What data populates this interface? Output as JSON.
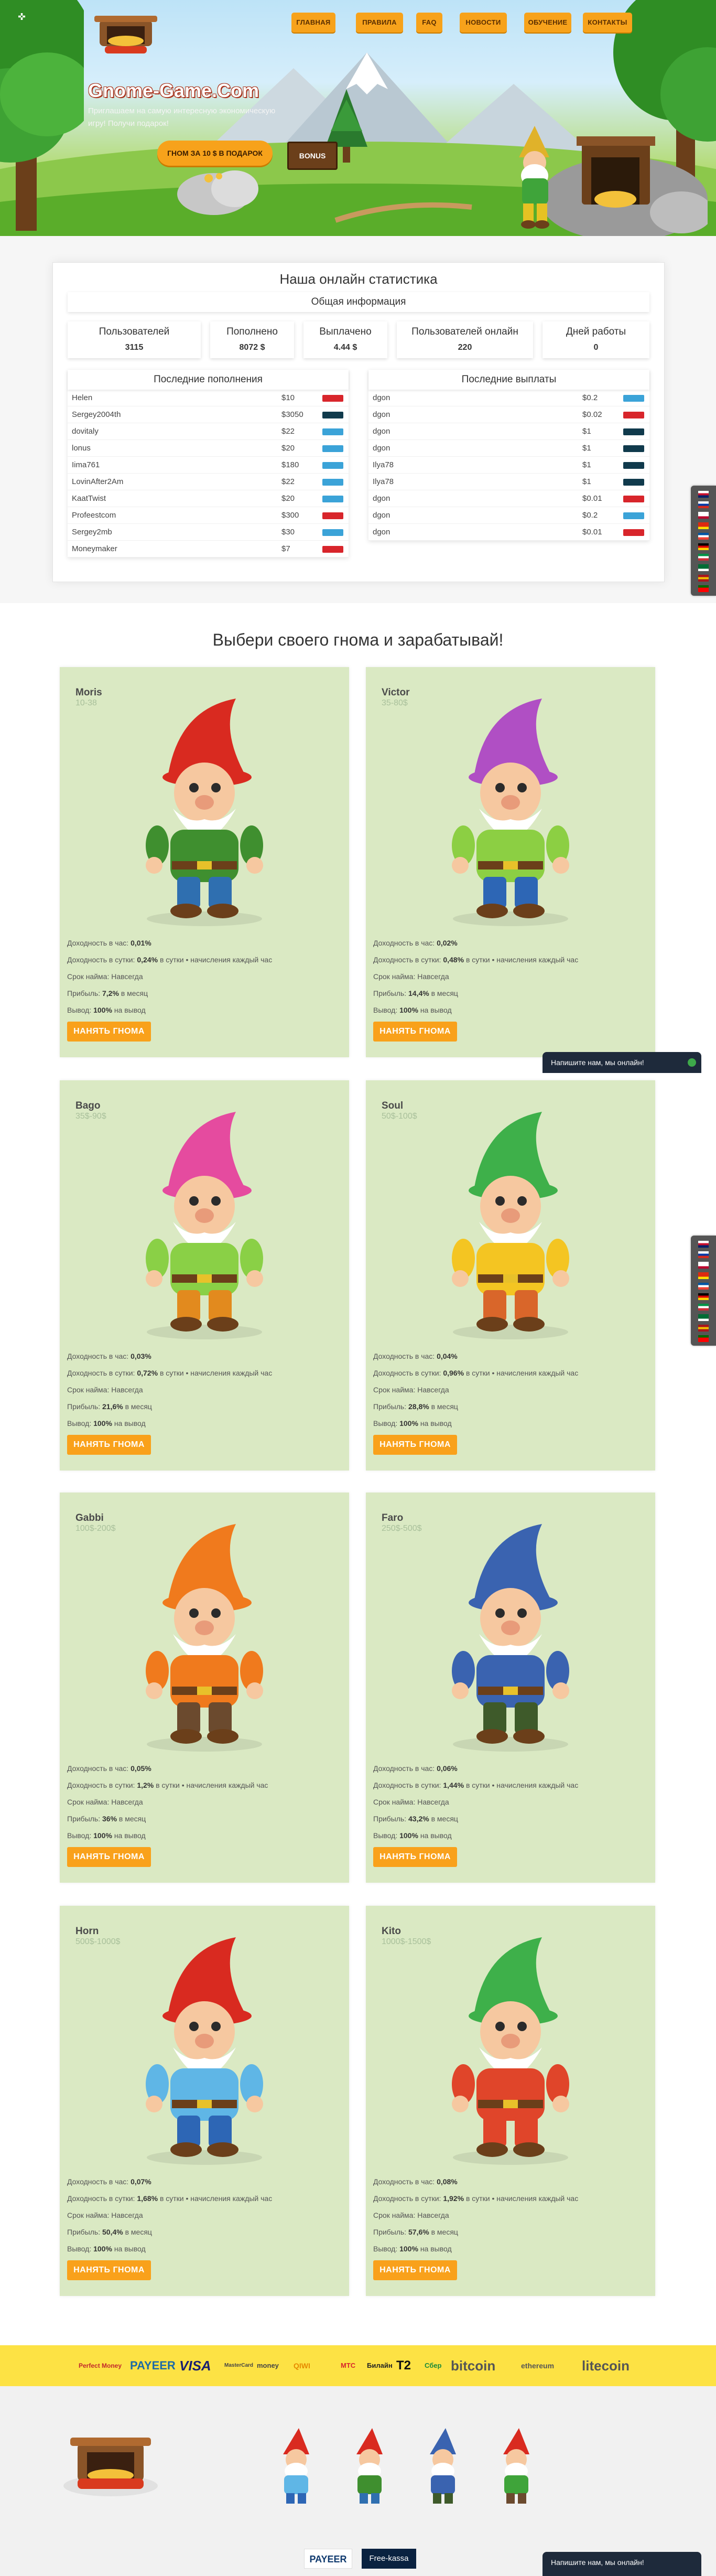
{
  "header": {
    "site_title": "Gnome-Game.Com",
    "subtitle": "Приглашаем на самую интересную экономическую игру! Получи подарок!",
    "bonus_button": "ГНОМ ЗА 10 $ В ПОДАРОК",
    "sign": "BONUS",
    "nav": [
      {
        "label": "ГЛАВНАЯ"
      },
      {
        "label": "ПРАВИЛА"
      },
      {
        "label": "FAQ"
      },
      {
        "label": "НОВОСТИ"
      },
      {
        "label": "ОБУЧЕНИЕ"
      },
      {
        "label": "КОНТАКТЫ"
      }
    ]
  },
  "stats": {
    "title": "Наша онлайн статистика",
    "general": "Общая информация",
    "cards": [
      {
        "label": "Пользователей",
        "value": "3115"
      },
      {
        "label": "Пополнено",
        "value": "8072 $"
      },
      {
        "label": "Выплачено",
        "value": "4.44 $"
      },
      {
        "label": "Пользователей онлайн",
        "value": "220"
      },
      {
        "label": "Дней работы",
        "value": "0"
      }
    ],
    "deposits_title": "Последние пополнения",
    "payouts_title": "Последние выплаты",
    "deposits": [
      {
        "name": "Helen",
        "amount": "$10",
        "ps": "pm"
      },
      {
        "name": "Sergey2004th",
        "amount": "$3050",
        "ps": "adv"
      },
      {
        "name": "dovitaly",
        "amount": "$22",
        "ps": "payeer"
      },
      {
        "name": "lonus",
        "amount": "$20",
        "ps": "payeer"
      },
      {
        "name": "Iima761",
        "amount": "$180",
        "ps": "payeer"
      },
      {
        "name": "LovinAfter2Am",
        "amount": "$22",
        "ps": "payeer"
      },
      {
        "name": "KaatTwist",
        "amount": "$20",
        "ps": "payeer"
      },
      {
        "name": "Profeestcom",
        "amount": "$300",
        "ps": "pm"
      },
      {
        "name": "Sergey2mb",
        "amount": "$30",
        "ps": "payeer"
      },
      {
        "name": "Moneymaker",
        "amount": "$7",
        "ps": "pm"
      }
    ],
    "payouts": [
      {
        "name": "dgon",
        "amount": "$0.2",
        "ps": "payeer"
      },
      {
        "name": "dgon",
        "amount": "$0.02",
        "ps": "pm"
      },
      {
        "name": "dgon",
        "amount": "$1",
        "ps": "adv"
      },
      {
        "name": "dgon",
        "amount": "$1",
        "ps": "adv"
      },
      {
        "name": "Ilya78",
        "amount": "$1",
        "ps": "adv"
      },
      {
        "name": "Ilya78",
        "amount": "$1",
        "ps": "adv"
      },
      {
        "name": "dgon",
        "amount": "$0.01",
        "ps": "pm"
      },
      {
        "name": "dgon",
        "amount": "$0.2",
        "ps": "payeer"
      },
      {
        "name": "dgon",
        "amount": "$0.01",
        "ps": "pm"
      }
    ]
  },
  "choose": {
    "title": "Выбери своего гнома и зарабатывай!",
    "hire_label": "НАНЯТЬ ГНОМА",
    "gnomes": [
      {
        "name": "Moris",
        "range": "10-38",
        "hour": "0,01%",
        "day": "0,24%",
        "period": "Навсегда",
        "profit": "7,2%",
        "withdraw": "100%",
        "hat": "#d92a20",
        "shirt": "#3f8f2f",
        "pants": "#2f6fb0"
      },
      {
        "name": "Victor",
        "range": "35-80$",
        "hour": "0,02%",
        "day": "0,48%",
        "period": "Навсегда",
        "profit": "14,4%",
        "withdraw": "100%",
        "hat": "#b04fc4",
        "shirt": "#8ccf43",
        "pants": "#2d66b5"
      },
      {
        "name": "Bago",
        "range": "35$-90$",
        "hour": "0,03%",
        "day": "0,72%",
        "period": "Навсегда",
        "profit": "21,6%",
        "withdraw": "100%",
        "hat": "#e54b9f",
        "shirt": "#8ad046",
        "pants": "#e28a1e"
      },
      {
        "name": "Soul",
        "range": "50$-100$",
        "hour": "0,04%",
        "day": "0,96%",
        "period": "Навсегда",
        "profit": "28,8%",
        "withdraw": "100%",
        "hat": "#3eb04a",
        "shirt": "#f4c522",
        "pants": "#d9662a"
      },
      {
        "name": "Gabbi",
        "range": "100$-200$",
        "hour": "0,05%",
        "day": "1,2%",
        "period": "Навсегда",
        "profit": "36%",
        "withdraw": "100%",
        "hat": "#f07a1d",
        "shirt": "#f07a1d",
        "pants": "#6b4a2e"
      },
      {
        "name": "Faro",
        "range": "250$-500$",
        "hour": "0,06%",
        "day": "1,44%",
        "period": "Навсегда",
        "profit": "43,2%",
        "withdraw": "100%",
        "hat": "#3a63b0",
        "shirt": "#3a63b0",
        "pants": "#3e5a2a"
      },
      {
        "name": "Horn",
        "range": "500$-1000$",
        "hour": "0,07%",
        "day": "1,68%",
        "period": "Навсегда",
        "profit": "50,4%",
        "withdraw": "100%",
        "hat": "#d92a20",
        "shirt": "#5fb6e6",
        "pants": "#2d66b5"
      },
      {
        "name": "Kito",
        "range": "1000$-1500$",
        "hour": "0,08%",
        "day": "1,92%",
        "period": "Навсегда",
        "profit": "57,6%",
        "withdraw": "100%",
        "hat": "#3eb04a",
        "shirt": "#e0452a",
        "pants": "#e0452a"
      }
    ],
    "labels": {
      "hour": "Доходность в час:",
      "day": "Доходность в сутки:",
      "day_suffix": "в сутки • начисления каждый час",
      "period": "Срок найма:",
      "profit": "Прибыль:",
      "profit_suffix": "в месяц",
      "withdraw": "Вывод:",
      "withdraw_suffix": "на вывод"
    }
  },
  "payments": [
    "Perfect Money",
    "PAYEER",
    "VISA",
    "MasterCard",
    "money",
    "QIWI",
    "МТС",
    "Билайн",
    "T2",
    "Сбер",
    "bitcoin",
    "ethereum",
    "litecoin"
  ],
  "footer": {
    "payeer": "PAYEER",
    "kassa": "Free-kassa"
  },
  "chat": {
    "label": "Напишите нам, мы онлайн!"
  }
}
